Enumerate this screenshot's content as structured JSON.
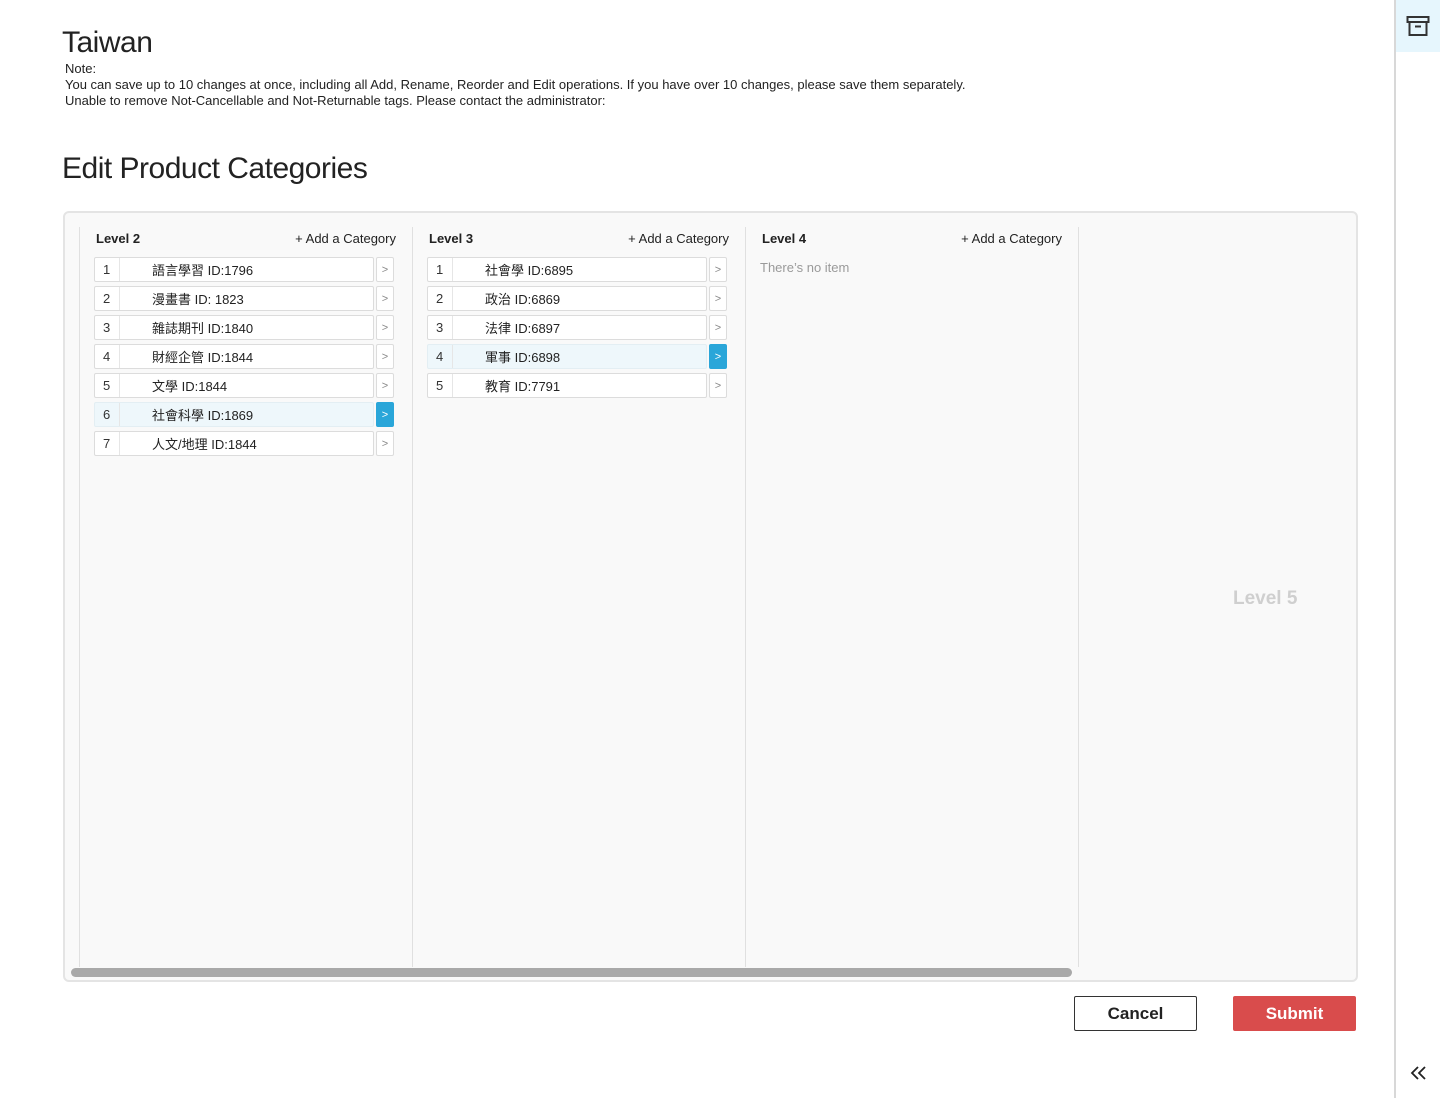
{
  "page": {
    "title": "Taiwan",
    "note_lines": [
      "Note:",
      "You can save up to 10 changes at once, including all Add, Rename, Reorder and Edit operations. If you have over 10 changes, please save them separately.",
      "Unable to remove Not-Cancellable and Not-Returnable tags. Please contact the administrator:"
    ],
    "section_title": "Edit Product Categories"
  },
  "columns": [
    {
      "title": "Level 2",
      "add_label": "+ Add a Category",
      "items": [
        {
          "num": "1",
          "label": "語言學習 ID:1796"
        },
        {
          "num": "2",
          "label": "漫畫書 ID: 1823"
        },
        {
          "num": "3",
          "label": "雜誌期刊 ID:1840"
        },
        {
          "num": "4",
          "label": "財經企管 ID:1844"
        },
        {
          "num": "5",
          "label": "文學 ID:1844"
        },
        {
          "num": "6",
          "label": "社會科學 ID:1869"
        },
        {
          "num": "7",
          "label": "人文/地理 ID:1844"
        }
      ],
      "selected_index": 5
    },
    {
      "title": "Level 3",
      "add_label": "+ Add a Category",
      "items": [
        {
          "num": "1",
          "label": "社會學 ID:6895"
        },
        {
          "num": "2",
          "label": "政治 ID:6869"
        },
        {
          "num": "3",
          "label": "法律 ID:6897"
        },
        {
          "num": "4",
          "label": "軍事 ID:6898"
        },
        {
          "num": "5",
          "label": "教育 ID:7791"
        }
      ],
      "selected_index": 3
    },
    {
      "title": "Level 4",
      "add_label": "+ Add a Category",
      "empty_text": "There’s no item",
      "items": []
    }
  ],
  "level5_label": "Level 5",
  "buttons": {
    "cancel": "Cancel",
    "submit": "Submit"
  },
  "icons": {
    "row_arrow": "chevron-right-icon",
    "rail_top": "archive-icon",
    "rail_bottom": "double-chevron-left-icon"
  },
  "colors": {
    "accent": "#2aa6d9",
    "submit": "#d94c4c",
    "selected_row_bg": "#eef7fb",
    "rail_highlight": "#e6f6fd"
  }
}
